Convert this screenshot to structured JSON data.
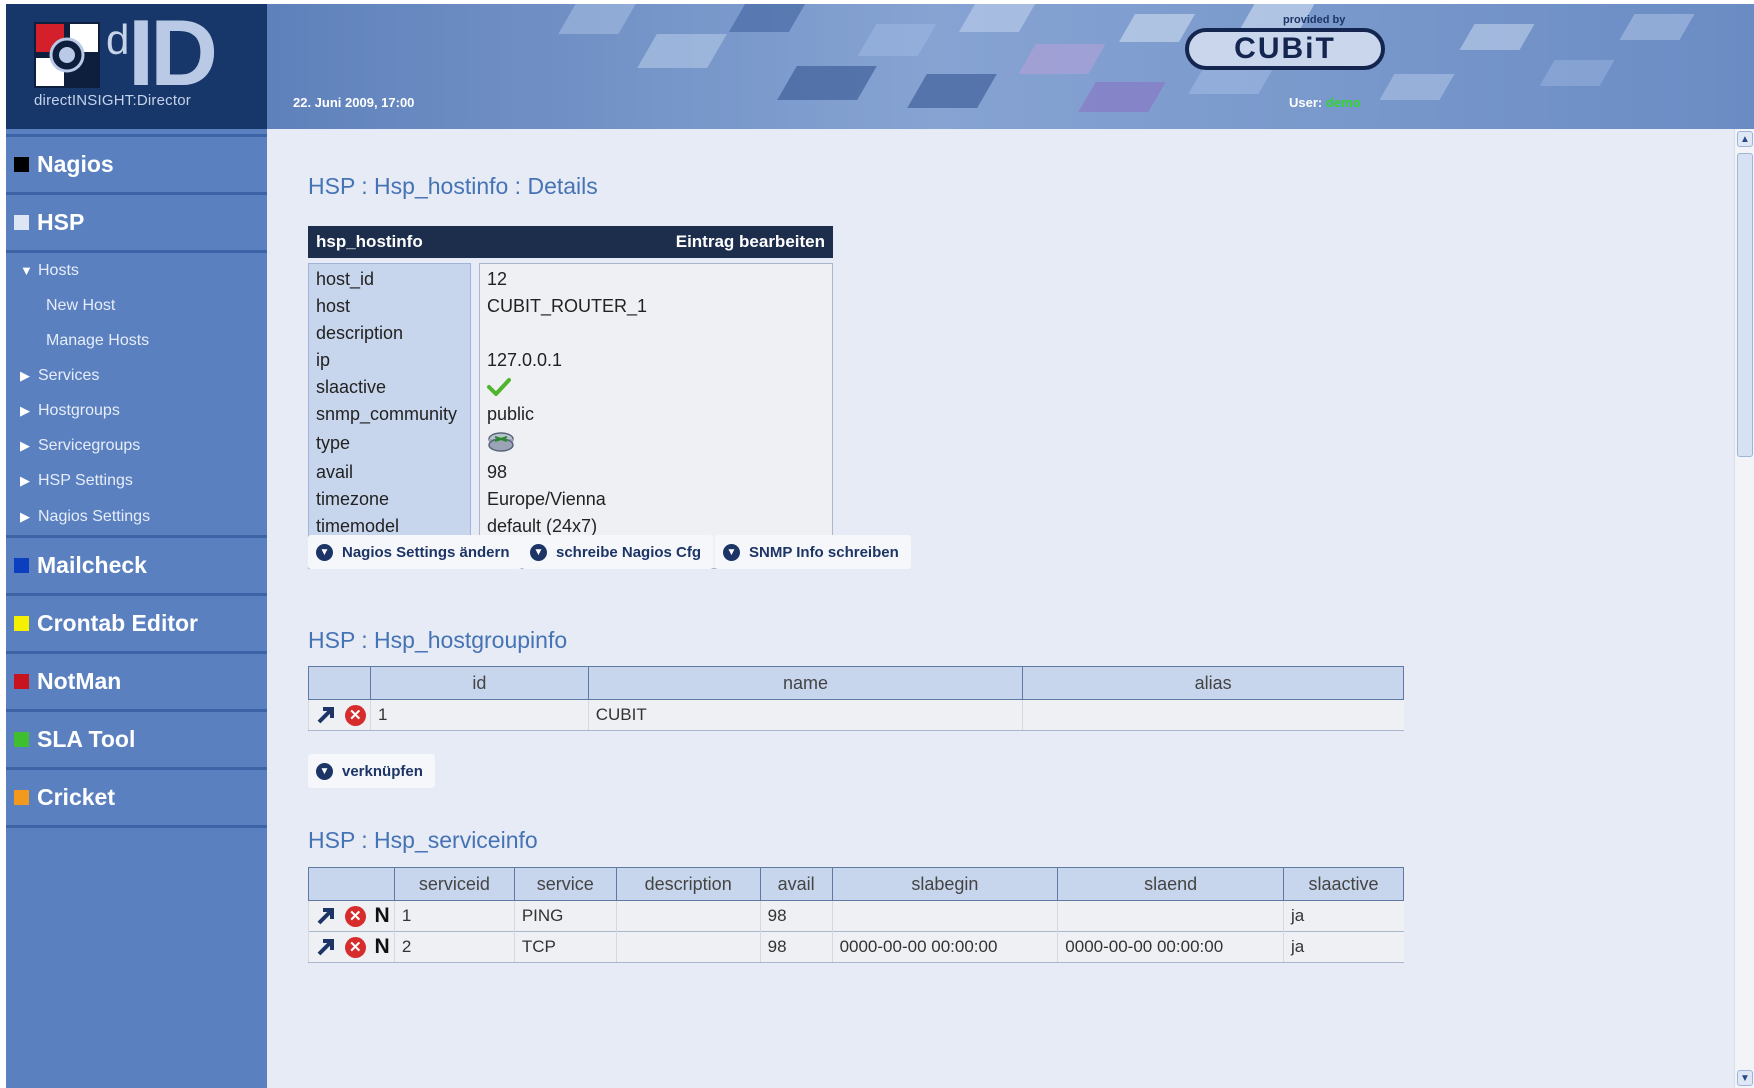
{
  "header": {
    "logo_d": "d",
    "logo_id": "ID",
    "logo_caption": "directINSIGHT:Director",
    "date": "22. Juni 2009, 17:00",
    "provided_by": "provided by",
    "cubit_logo": "CUBiT",
    "user_label": "User:",
    "user_name": "demo"
  },
  "sidebar": {
    "categories": [
      {
        "label": "Nagios",
        "color": "#000000"
      },
      {
        "label": "HSP",
        "color": "#dce6f5"
      },
      {
        "label": "Mailcheck",
        "color": "#0b3fbf"
      },
      {
        "label": "Crontab Editor",
        "color": "#f4f000"
      },
      {
        "label": "NotMan",
        "color": "#c8141e"
      },
      {
        "label": "SLA Tool",
        "color": "#3fbf2f"
      },
      {
        "label": "Cricket",
        "color": "#f39a1e"
      }
    ],
    "hsp_items": [
      {
        "label": "Hosts",
        "expanded": true
      },
      {
        "label": "New Host"
      },
      {
        "label": "Manage Hosts"
      },
      {
        "label": "Services"
      },
      {
        "label": "Hostgroups"
      },
      {
        "label": "Servicegroups"
      },
      {
        "label": "HSP Settings"
      },
      {
        "label": "Nagios Settings"
      }
    ]
  },
  "details": {
    "title": "HSP : Hsp_hostinfo : Details",
    "table_name": "hsp_hostinfo",
    "edit_label": "Eintrag bearbeiten",
    "rows": [
      {
        "key": "host_id",
        "value": "12"
      },
      {
        "key": "host",
        "value": "CUBIT_ROUTER_1"
      },
      {
        "key": "description",
        "value": ""
      },
      {
        "key": "ip",
        "value": "127.0.0.1"
      },
      {
        "key": "slaactive",
        "value": "",
        "icon": "check-icon"
      },
      {
        "key": "snmp_community",
        "value": "public"
      },
      {
        "key": "type",
        "value": "",
        "icon": "router-icon"
      },
      {
        "key": "avail",
        "value": "98"
      },
      {
        "key": "timezone",
        "value": "Europe/Vienna"
      },
      {
        "key": "timemodel",
        "value": "default (24x7)"
      }
    ],
    "buttons": [
      "Nagios Settings ändern",
      "schreibe Nagios Cfg",
      "SNMP Info schreiben"
    ]
  },
  "hostgroups": {
    "title": "HSP : Hsp_hostgroupinfo",
    "columns": [
      "",
      "id",
      "name",
      "alias"
    ],
    "rows": [
      {
        "id": "1",
        "name": "CUBIT",
        "alias": ""
      }
    ],
    "link_button": "verknüpfen"
  },
  "services": {
    "title": "HSP : Hsp_serviceinfo",
    "columns": [
      "",
      "serviceid",
      "service",
      "description",
      "avail",
      "slabegin",
      "slaend",
      "slaactive"
    ],
    "rows": [
      {
        "serviceid": "1",
        "service": "PING",
        "description": "",
        "avail": "98",
        "slabegin": "",
        "slaend": "",
        "slaactive": "ja"
      },
      {
        "serviceid": "2",
        "service": "TCP",
        "description": "",
        "avail": "98",
        "slabegin": "0000-00-00 00:00:00",
        "slaend": "0000-00-00 00:00:00",
        "slaactive": "ja"
      }
    ],
    "n_label": "N"
  },
  "icons": {
    "edit": "arrow-up-right-icon",
    "delete": "delete-icon",
    "nagios": "n-icon",
    "chevron": "chevron-down-icon"
  }
}
